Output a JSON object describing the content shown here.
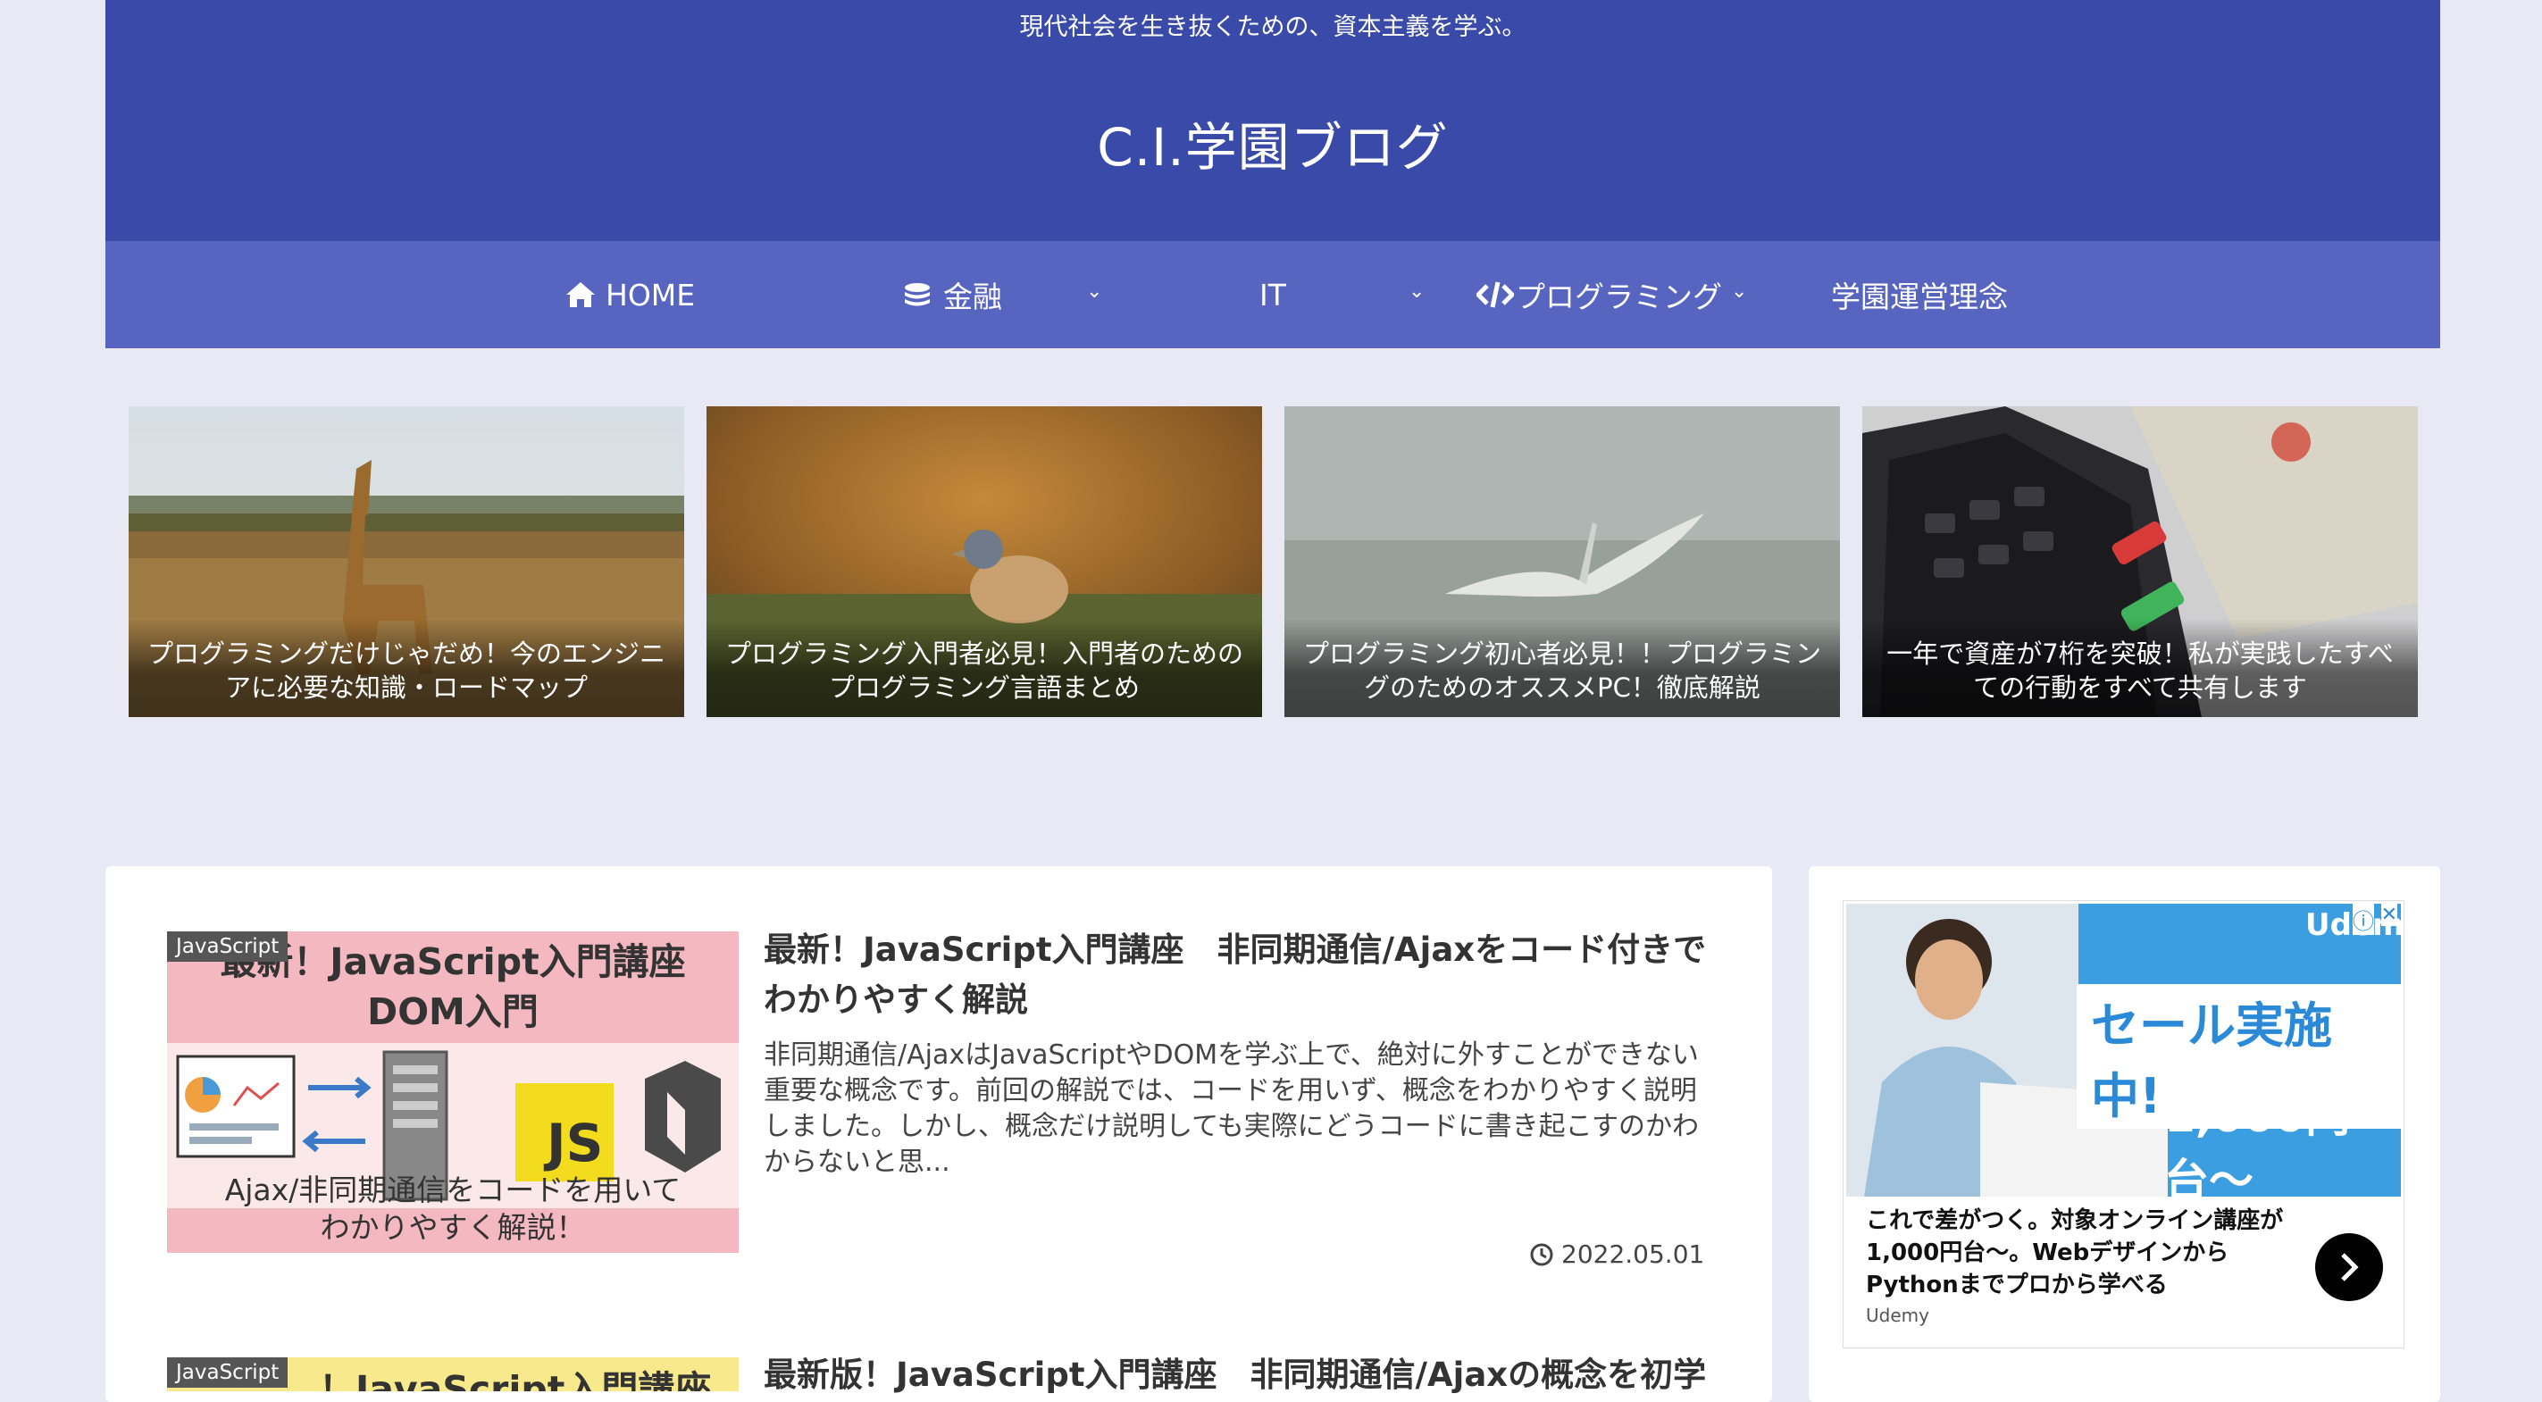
{
  "header": {
    "tagline": "現代社会を生き抜くための、資本主義を学ぶ。",
    "site_title": "C.I.学園ブログ"
  },
  "nav": {
    "items": [
      {
        "label": "HOME",
        "icon": "home-icon"
      },
      {
        "label": "金融",
        "icon": "coins-icon"
      },
      {
        "label": "IT"
      },
      {
        "label": "プログラミング",
        "icon": "code-icon"
      },
      {
        "label": "学園運営理念"
      }
    ],
    "caret": "⌄"
  },
  "slider": [
    {
      "caption": "プログラミングだけじゃだめ！今のエンジニアに必要な知識・ロードマップ",
      "image": "giraffe-photo"
    },
    {
      "caption": "プログラミング入門者必見！入門者のためのプログラミング言語まとめ",
      "image": "bird-photo"
    },
    {
      "caption": "プログラミング初心者必見！！プログラミングのためのオススメPC！徹底解説",
      "image": "pelican-photo"
    },
    {
      "caption": "一年で資産が7桁を突破！私が実践したすべての行動をすべて共有します",
      "image": "card-terminal-photo"
    }
  ],
  "posts": [
    {
      "category": "JavaScript",
      "title": "最新！JavaScript入門講座　非同期通信/Ajaxをコード付きでわかりやすく解説",
      "excerpt": "非同期通信/AjaxはJavaScriptやDOMを学ぶ上で、絶対に外すことができない重要な概念です。前回の解説では、コードを用いず、概念をわかりやすく説明しました。しかし、概念だけ説明しても実際にどうコードに書き起こすのかわからないと思...",
      "date": "2022.05.01",
      "thumb": {
        "line1": "最新！JavaScript入門講座",
        "line2": "DOM入門",
        "badge": "JS",
        "caption1": "Ajax/非同期通信をコードを用いて",
        "caption2": "わかりやすく解説！"
      }
    },
    {
      "category": "JavaScript",
      "title": "最新版！JavaScript入門講座　非同期通信/Ajaxの概念を初学",
      "thumb": {
        "line1": "！JavaScript入門講座"
      }
    }
  ],
  "ad": {
    "brand": "Udemy",
    "headline": "セール実施中!",
    "sub": "対象のオンライン講座が",
    "price": "1,000円台〜",
    "text": "これで差がつく。対象オンライン講座が1,000円台〜。WebデザインからPythonまでプロから学べる",
    "source": "Udemy",
    "info_icon": "ⓘ",
    "close_icon": "✕"
  },
  "colors": {
    "header": "#3a4aa8",
    "nav": "#5865c0",
    "background": "#e8e9f4"
  }
}
